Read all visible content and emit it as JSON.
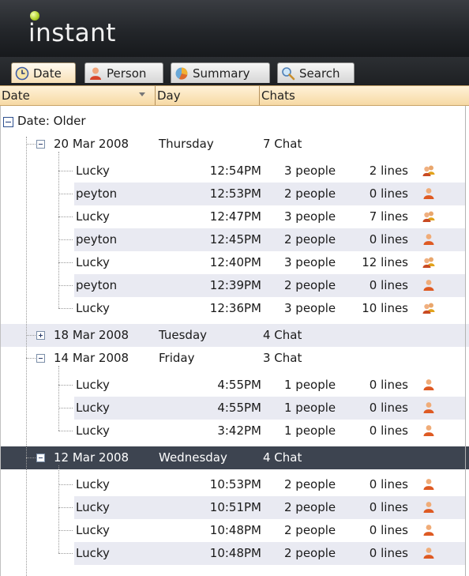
{
  "app": {
    "logo": "instant"
  },
  "tabs": [
    {
      "label": "Date",
      "icon": "clock-icon",
      "active": true
    },
    {
      "label": "Person",
      "icon": "person-icon",
      "active": false
    },
    {
      "label": "Summary",
      "icon": "summary-icon",
      "active": false
    },
    {
      "label": "Search",
      "icon": "search-icon",
      "active": false
    }
  ],
  "columns": [
    "Date",
    "Day",
    "Chats"
  ],
  "tree": {
    "root_label": "Date: Older",
    "groups": [
      {
        "date": "20 Mar 2008",
        "day": "Thursday",
        "chats": "7 Chat",
        "expanded": true,
        "items": [
          {
            "name": "Lucky",
            "time": "12:54PM",
            "people": "3 people",
            "lines": "2 lines",
            "icon": "group-icon"
          },
          {
            "name": "peyton",
            "time": "12:53PM",
            "people": "2 people",
            "lines": "0 lines",
            "icon": "person-icon"
          },
          {
            "name": "Lucky",
            "time": "12:47PM",
            "people": "3 people",
            "lines": "7 lines",
            "icon": "group-icon"
          },
          {
            "name": "peyton",
            "time": "12:45PM",
            "people": "2 people",
            "lines": "0 lines",
            "icon": "person-icon"
          },
          {
            "name": "Lucky",
            "time": "12:40PM",
            "people": "3 people",
            "lines": "12 lines",
            "icon": "group-icon"
          },
          {
            "name": "peyton",
            "time": "12:39PM",
            "people": "2 people",
            "lines": "0 lines",
            "icon": "person-icon"
          },
          {
            "name": "Lucky",
            "time": "12:36PM",
            "people": "3 people",
            "lines": "10 lines",
            "icon": "group-icon"
          }
        ]
      },
      {
        "date": "18 Mar 2008",
        "day": "Tuesday",
        "chats": "4 Chat",
        "expanded": false,
        "items": []
      },
      {
        "date": "14 Mar 2008",
        "day": "Friday",
        "chats": "3 Chat",
        "expanded": true,
        "items": [
          {
            "name": "Lucky",
            "time": "4:55PM",
            "people": "1 people",
            "lines": "0 lines",
            "icon": "person-icon"
          },
          {
            "name": "Lucky",
            "time": "4:55PM",
            "people": "1 people",
            "lines": "0 lines",
            "icon": "person-icon"
          },
          {
            "name": "Lucky",
            "time": "3:42PM",
            "people": "1 people",
            "lines": "0 lines",
            "icon": "person-icon"
          }
        ]
      },
      {
        "date": "12 Mar 2008",
        "day": "Wednesday",
        "chats": "4 Chat",
        "expanded": true,
        "selected": true,
        "items": [
          {
            "name": "Lucky",
            "time": "10:53PM",
            "people": "2 people",
            "lines": "0 lines",
            "icon": "person-icon"
          },
          {
            "name": "Lucky",
            "time": "10:51PM",
            "people": "2 people",
            "lines": "0 lines",
            "icon": "person-icon"
          },
          {
            "name": "Lucky",
            "time": "10:48PM",
            "people": "2 people",
            "lines": "0 lines",
            "icon": "person-icon"
          },
          {
            "name": "Lucky",
            "time": "10:48PM",
            "people": "2 people",
            "lines": "0 lines",
            "icon": "person-icon"
          }
        ]
      }
    ]
  },
  "colors": {
    "titlebar": "#23262a",
    "header": "#f6d9a4",
    "alt_row": "#e9eaf2",
    "selected_row": "#3d4450"
  }
}
